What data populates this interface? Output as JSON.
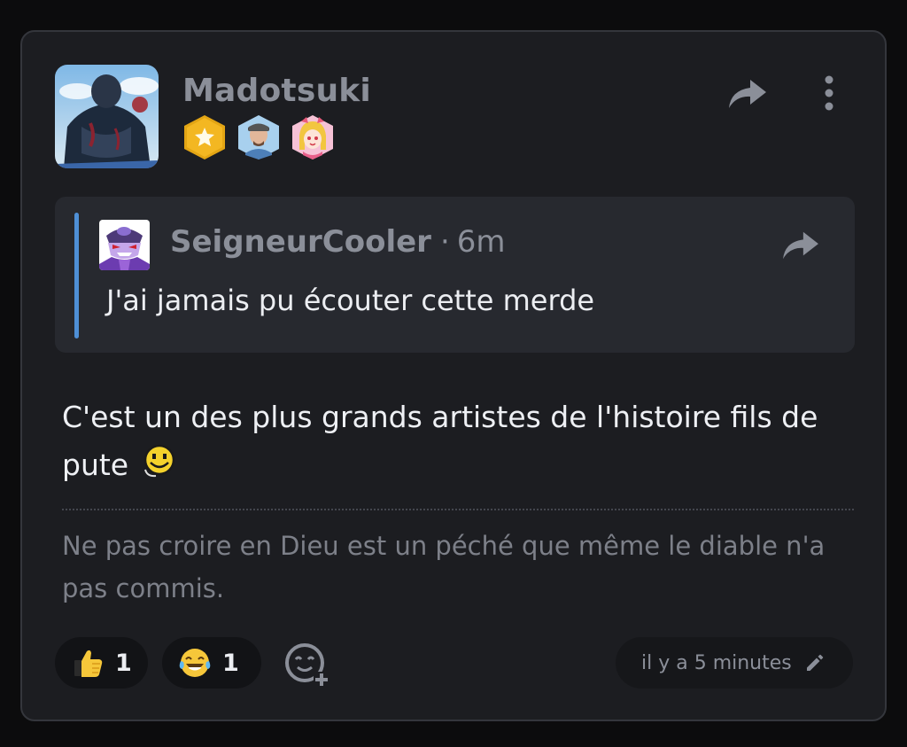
{
  "post": {
    "author": "Madotsuki",
    "badges": [
      {
        "icon": "gold-star-hexagon-icon",
        "color": "#e8a812"
      },
      {
        "icon": "man-avatar-hexagon-icon",
        "color": "#8fc0e8"
      },
      {
        "icon": "anime-girl-hexagon-icon",
        "color": "#f2a8c8"
      }
    ],
    "share_icon": "share-arrow-icon",
    "more_icon": "vertical-dots-icon"
  },
  "quote": {
    "author": "SeigneurCooler",
    "separator": "·",
    "time": "6m",
    "text": "J'ai jamais pu écouter cette merde",
    "bar_color": "#4e8fd6"
  },
  "message": {
    "text": "C'est un des plus grands artistes de l'histoire fils de pute",
    "emoji": "pixel-smiley-icon"
  },
  "signature": {
    "text": "Ne pas croire en Dieu est un péché que même le diable n'a pas commis."
  },
  "reactions": [
    {
      "icon": "thumbs-up-icon",
      "count": "1"
    },
    {
      "icon": "laughing-tears-icon",
      "count": "1"
    }
  ],
  "add_reaction_icon": "add-reaction-icon",
  "footer": {
    "timestamp": "il y a 5 minutes",
    "edit_icon": "pencil-icon"
  }
}
